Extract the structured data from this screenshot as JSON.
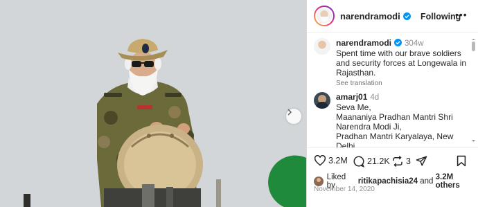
{
  "post": {
    "author": "narendramodi",
    "follow_label": "Following",
    "more_label": "•••"
  },
  "caption": {
    "user": "narendramodi",
    "time": "304w",
    "text": "Spent time with our brave soldiers and security forces at Longewala in Rajasthan.",
    "translation": "See translation"
  },
  "comment": {
    "user": "amarj01",
    "time": "4d",
    "lines": [
      "Seva Me,",
      "Maananiya Pradhan Mantri Shri",
      "Narendra Modi Ji,",
      "Pradhan Mantri Karyalaya, New",
      "Delhi"
    ]
  },
  "actions": {
    "likes_count": "3.2M",
    "comments_count": "21.2K",
    "reposts_count": "3"
  },
  "liked_by": {
    "prefix": "Liked by",
    "user": "ritikapachisia24",
    "joiner": "and",
    "others": "3.2M others"
  },
  "date": "November 14, 2020",
  "icons": {
    "verified": "verified-badge-icon",
    "like": "heart-icon",
    "comment": "comment-bubble-icon",
    "repost": "repost-icon",
    "share": "paper-plane-icon",
    "save": "bookmark-icon",
    "next": "chevron-right-icon"
  },
  "colors": {
    "verified_blue": "#0095f6",
    "camo_base": "#6b6a3a",
    "cap_tan": "#c8a96e"
  }
}
